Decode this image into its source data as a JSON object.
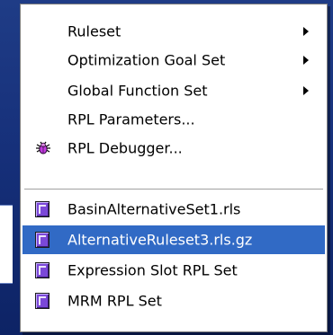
{
  "menu": {
    "items": [
      {
        "label": "Ruleset",
        "submenu": true
      },
      {
        "label": "Optimization Goal Set",
        "submenu": true
      },
      {
        "label": "Global Function Set",
        "submenu": true
      },
      {
        "label": "RPL Parameters...",
        "submenu": false
      },
      {
        "label": "RPL Debugger...",
        "icon": "bug-icon",
        "submenu": false
      },
      {
        "label": "BasinAlternativeSet1.rls",
        "icon": "ruleset-file-icon",
        "submenu": false
      },
      {
        "label": "AlternativeRuleset3.rls.gz",
        "icon": "ruleset-file-icon",
        "submenu": false,
        "selected": true
      },
      {
        "label": "Expression Slot RPL Set",
        "icon": "ruleset-file-icon",
        "submenu": false
      },
      {
        "label": "MRM RPL Set",
        "icon": "ruleset-file-icon",
        "submenu": false
      }
    ]
  },
  "colors": {
    "background": "#16307a",
    "menu_background": "#ffffff",
    "selection": "#316ac5",
    "selection_text": "#ffffff",
    "file_icon": "#7b48d8"
  }
}
